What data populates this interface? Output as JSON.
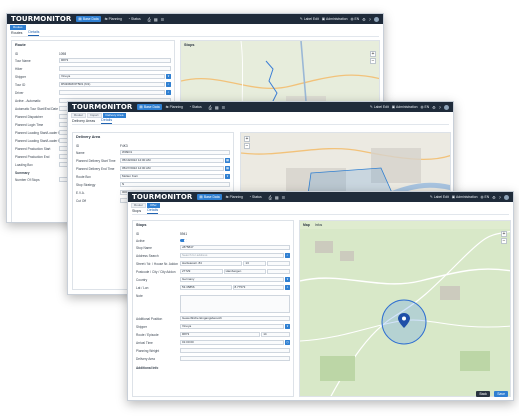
{
  "common": {
    "logo": "TOURMONITOR",
    "nav": {
      "base_data": "Base Data",
      "planning": "Planning",
      "status": "Status",
      "label_edit": "Label Edit",
      "administration": "Administration",
      "lang": "EN"
    },
    "icons": [
      "printer-icon",
      "calendar-icon",
      "list-icon",
      "bell-icon",
      "gear-icon",
      "question-icon",
      "user-avatar"
    ]
  },
  "w1": {
    "crumbs": [
      "Routes"
    ],
    "tabs": [
      "Routes",
      "Details"
    ],
    "panel_title": "Route",
    "map_title": "Stops",
    "fields": [
      {
        "label": "ID",
        "value": "1098"
      },
      {
        "label": "Tour Name",
        "value": "R873"
      },
      {
        "label": "Hiker",
        "value": ""
      },
      {
        "label": "Shipper",
        "value": "Vinoya"
      },
      {
        "label": "Tour ID",
        "value": "R54D6RF6T5R1 (6/1)"
      },
      {
        "label": "Driver",
        "value": ""
      },
      {
        "label": "Active - Automatic",
        "value": ""
      },
      {
        "label": "Automatic Tour Start/End Date",
        "value": ""
      },
      {
        "label": "Planned Dispatcher",
        "value": ""
      },
      {
        "label": "Planned Login Time",
        "value": ""
      },
      {
        "label": "Planned Loading Start/Loader Route",
        "value": ""
      },
      {
        "label": "Planned Loading Start/Loader Finish",
        "value": ""
      },
      {
        "label": "Planned Production Start",
        "value": ""
      },
      {
        "label": "Planned Production End",
        "value": ""
      },
      {
        "label": "Loading Box",
        "value": ""
      },
      {
        "label": "Summary",
        "value": ""
      },
      {
        "label": "Number Of Stops",
        "value": ""
      }
    ]
  },
  "w2": {
    "crumbs": [
      "Router",
      "Import",
      "Delivery Area"
    ],
    "tabs": [
      "Delivery Areas",
      "Details"
    ],
    "panel_title": "Delivery Area",
    "fields": [
      {
        "label": "ID",
        "value": "F4K3"
      },
      {
        "label": "Name",
        "value": "W09O1"
      },
      {
        "label": "Planned Delivery Start Time",
        "value": "05/19/2022 12:00 AM"
      },
      {
        "label": "Planned Delivery End Time",
        "value": "05/27/2022 12:00 AM"
      },
      {
        "label": "Route Box",
        "value": "Molten Korn"
      },
      {
        "label": "Stop Strategy",
        "value": "N"
      },
      {
        "label": "E.V.A.",
        "value": "0000..0.7"
      },
      {
        "label": "Cut Off",
        "value": ""
      }
    ]
  },
  "w3": {
    "crumbs": [
      "Router",
      "Offer"
    ],
    "tabs": [
      "Stops",
      "Details"
    ],
    "panel_title": "Stops",
    "map_tabs": [
      "Map",
      "Infos"
    ],
    "fields": [
      {
        "label": "ID",
        "value": "5941"
      },
      {
        "label": "Active",
        "value": ""
      },
      {
        "label": "Stop Name",
        "value": "v875847"
      },
      {
        "label": "Address Search",
        "value": "Search for address"
      },
      {
        "label": "Street / Nr. / House Nr. Addon",
        "value": "Hartwiesstr. 84",
        "extra": "13"
      },
      {
        "label": "Postcode / City / City Addon",
        "value": "27729",
        "extra": "Hambergen"
      },
      {
        "label": "Country",
        "value": "Germany"
      },
      {
        "label": "Lat / Lon",
        "value": "53.35856",
        "extra": "8.77573"
      },
      {
        "label": "Note",
        "value": ""
      },
      {
        "label": "Additional Position",
        "value": "Gewerbliche Eingangsbereich"
      },
      {
        "label": "Shipper",
        "value": "Vinoya"
      },
      {
        "label": "Route / Episode",
        "value": "R873",
        "extra": "14"
      },
      {
        "label": "Arrival Time",
        "value": "01:00:00"
      },
      {
        "label": "Planning Weight",
        "value": ""
      },
      {
        "label": "Delivery Area",
        "value": ""
      },
      {
        "label": "Additional Info",
        "value": ""
      }
    ],
    "buttons": {
      "back": "Back",
      "save": "Save"
    }
  }
}
